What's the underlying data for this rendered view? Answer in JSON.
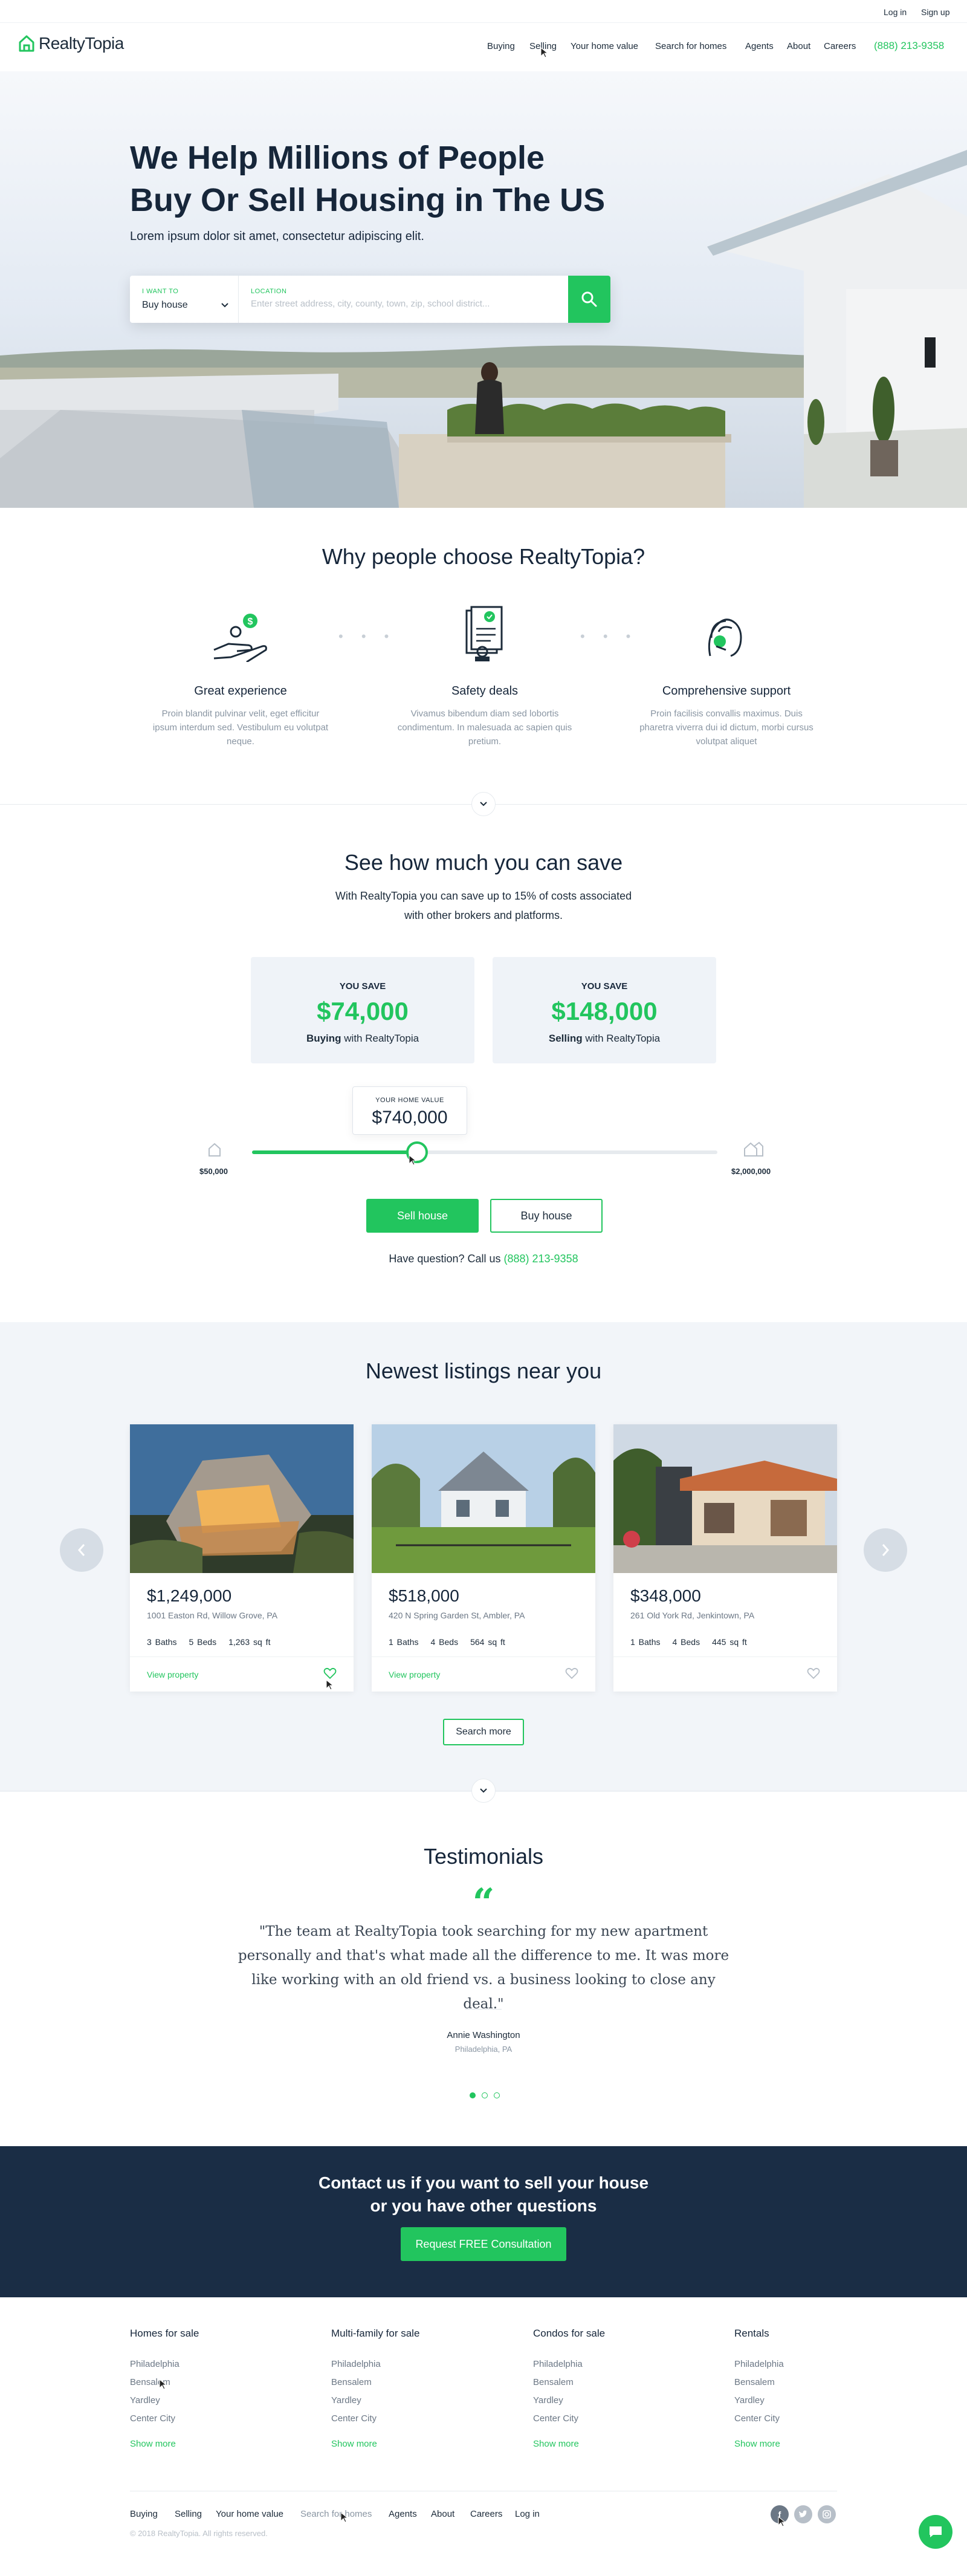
{
  "topbar": {
    "login": "Log in",
    "signup": "Sign up"
  },
  "header": {
    "logo": "RealtyTopia",
    "nav": [
      "Buying",
      "Selling",
      "Your home value",
      "Search for homes",
      "Agents",
      "About",
      "Careers"
    ],
    "phone": "(888) 213-9358"
  },
  "hero": {
    "title": "We Help Millions of People Buy Or Sell Housing in The US",
    "subtitle": "Lorem ipsum dolor sit amet, consectetur adipiscing elit.",
    "search": {
      "want_label": "I want to",
      "want_value": "Buy house",
      "location_label": "Location",
      "location_placeholder": "Enter street address, city, county, town, zip, school district..."
    }
  },
  "why": {
    "title": "Why people choose RealtyTopia?",
    "features": [
      {
        "title": "Great experience",
        "text": "Proin blandit pulvinar velit, eget efficitur ipsum interdum sed. Vestibulum eu volutpat neque."
      },
      {
        "title": "Safety deals",
        "text": "Vivamus bibendum diam sed lobortis condimentum. In malesuada ac sapien quis pretium."
      },
      {
        "title": "Comprehensive support",
        "text": "Proin facilisis convallis maximus. Duis pharetra viverra dui id dictum, morbi cursus volutpat aliquet"
      }
    ]
  },
  "save": {
    "title": "See how much you can save",
    "subtitle_line1": "With RealtyTopia you can save up to 15% of costs associated",
    "subtitle_line2": "with other brokers and platforms.",
    "cards": [
      {
        "label": "YOU SAVE",
        "amount": "$74,000",
        "bold": "Buying",
        "rest": " with RealtyTopia"
      },
      {
        "label": "YOU SAVE",
        "amount": "$148,000",
        "bold": "Selling",
        "rest": " with RealtyTopia"
      }
    ],
    "slider": {
      "tooltip_label": "Your home value",
      "tooltip_value": "$740,000",
      "min_label": "$50,000",
      "max_label": "$2,000,000",
      "position_fraction": 0.354
    },
    "sell_button": "Sell house",
    "buy_button": "Buy house",
    "question_text": "Have question? Call us ",
    "question_phone": "(888) 213-9358"
  },
  "listings": {
    "title": "Newest listings near you",
    "cards": [
      {
        "price": "$1,249,000",
        "address": "1001 Easton Rd, Willow Grove, PA",
        "baths": "3 Baths",
        "beds": "5 Beds",
        "sqft": "1,263 sq ft",
        "link": "View property"
      },
      {
        "price": "$518,000",
        "address": "420 N Spring Garden St, Ambler, PA",
        "baths": "1 Baths",
        "beds": "4 Beds",
        "sqft": "564 sq ft",
        "link": "View property"
      },
      {
        "price": "$348,000",
        "address": "261 Old York Rd, Jenkintown, PA",
        "baths": "1 Baths",
        "beds": "4 Beds",
        "sqft": "445 sq ft",
        "link": ""
      }
    ],
    "more_button": "Search more"
  },
  "testimonials": {
    "title": "Testimonials",
    "quote": "\"The team at RealtyTopia took searching for my new apartment personally and that's what made all the difference to me. It was more like working with an old friend vs. a business looking to close any deal.\"",
    "name": "Annie Washington",
    "city": "Philadelphia, PA"
  },
  "contact": {
    "title_line1": "Contact us if you want to sell your house",
    "title_line2": "or you have other questions",
    "button": "Request FREE Consultation"
  },
  "footer": {
    "columns": [
      {
        "title": "Homes for sale",
        "links": [
          "Philadelphia",
          "Bensalem",
          "Yardley",
          "Center City"
        ],
        "more": "Show more"
      },
      {
        "title": "Multi-family for sale",
        "links": [
          "Philadelphia",
          "Bensalem",
          "Yardley",
          "Center City"
        ],
        "more": "Show more"
      },
      {
        "title": "Condos for sale",
        "links": [
          "Philadelphia",
          "Bensalem",
          "Yardley",
          "Center City"
        ],
        "more": "Show more"
      },
      {
        "title": "Rentals",
        "links": [
          "Philadelphia",
          "Bensalem",
          "Yardley",
          "Center City"
        ],
        "more": "Show more"
      }
    ],
    "nav": [
      "Buying",
      "Selling",
      "Your home value",
      "Search for homes",
      "Agents",
      "About",
      "Careers",
      "Log in"
    ],
    "copyright": "© 2018 RealtyTopia. All rights reserved.",
    "social": [
      "facebook-icon",
      "twitter-icon",
      "instagram-icon"
    ]
  },
  "colors": {
    "accent": "#22c55e",
    "navy": "#1a2d45",
    "text": "#16263a",
    "muted": "#8a96a3"
  }
}
